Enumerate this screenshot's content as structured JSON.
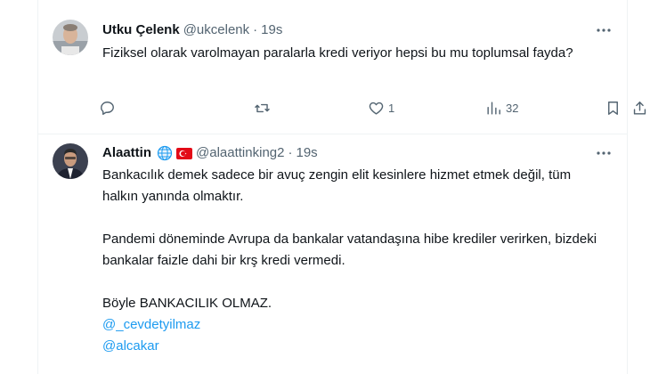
{
  "tweets": [
    {
      "name": "Utku Çelenk",
      "handle": "@ukcelenk",
      "separator": "·",
      "time": "19s",
      "text": "Fiziksel olarak varolmayan paralarla kredi veriyor hepsi bu mu toplumsal fayda?",
      "actions": {
        "reply_count": "",
        "retweet_count": "",
        "like_count": "1",
        "views_count": "32"
      }
    },
    {
      "name": "Alaattin",
      "handle": "@alaattinking2",
      "separator": "·",
      "time": "19s",
      "paragraphs": [
        "Bankacılık demek sadece bir avuç zengin elit kesinlere hizmet etmek değil, tüm halkın yanında olmaktır.",
        "Pandemi döneminde Avrupa da bankalar vatandaşına hibe krediler verirken, bizdeki bankalar faizle dahi bir krş kredi vermedi.",
        "Böyle BANKACILIK OLMAZ."
      ],
      "mentions": [
        "@_cevdetyilmaz",
        "@alcakar"
      ]
    }
  ],
  "colors": {
    "text": "#0f1419",
    "secondary": "#536471",
    "link": "#1d9bf0",
    "border": "#eff3f4"
  },
  "icons": {
    "more": "more-icon",
    "reply": "reply-icon",
    "retweet": "retweet-icon",
    "like": "heart-icon",
    "views": "views-icon",
    "bookmark": "bookmark-icon",
    "share": "share-icon"
  }
}
